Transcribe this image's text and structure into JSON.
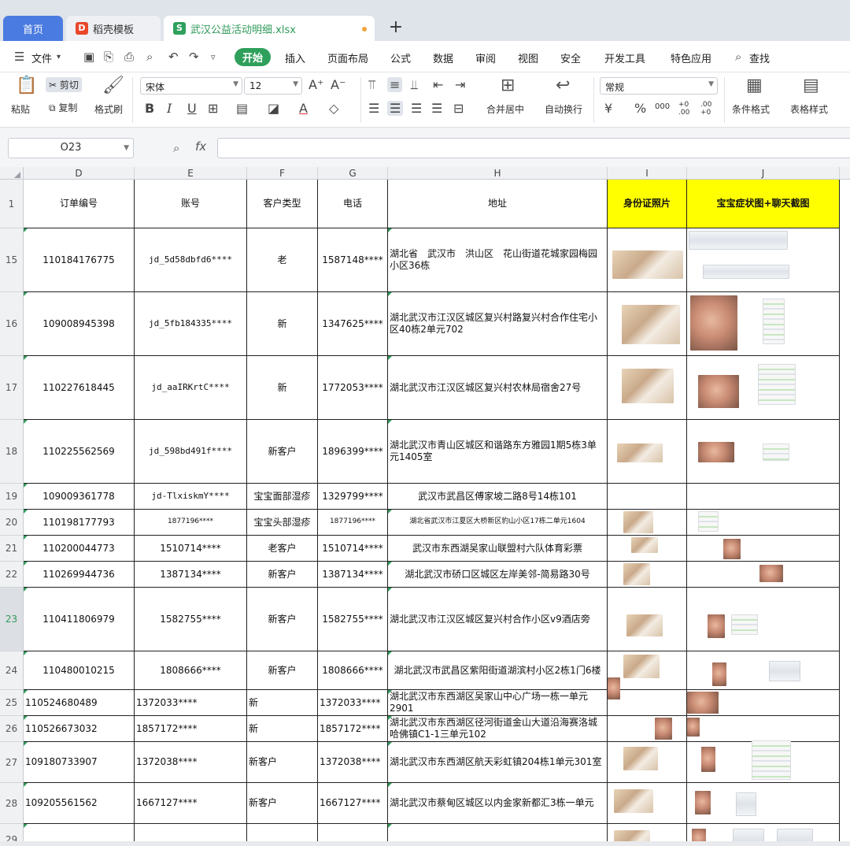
{
  "tabs": {
    "home": "首页",
    "template": "稻壳模板",
    "file": "武汉公益活动明细.xlsx",
    "add": "+"
  },
  "menu": {
    "file": "文件",
    "items": [
      "开始",
      "插入",
      "页面布局",
      "公式",
      "数据",
      "审阅",
      "视图",
      "安全",
      "开发工具",
      "特色应用"
    ],
    "search": "查找"
  },
  "ribbon": {
    "paste": "粘贴",
    "cut": "剪切",
    "copy": "复制",
    "format_painter": "格式刷",
    "font_name": "宋体",
    "font_size": "12",
    "bold": "B",
    "italic": "I",
    "underline": "U",
    "merge_center": "合并居中",
    "wrap_text": "自动换行",
    "number_format": "常规",
    "percent": "%",
    "thousands": "000",
    "inc_decimal": "+0 .00",
    "dec_decimal": ".00 +0",
    "conditional_format": "条件格式",
    "table_style": "表格样式"
  },
  "formula_bar": {
    "name_box": "O23",
    "fx": "fx",
    "formula": ""
  },
  "columns": [
    "D",
    "E",
    "F",
    "G",
    "H",
    "I",
    "J"
  ],
  "header_row": {
    "row": "1",
    "cells": [
      "订单编号",
      "账号",
      "客户类型",
      "电话",
      "地址",
      "身份证照片",
      "宝宝症状图+聊天截图"
    ]
  },
  "rows": [
    {
      "row": "15",
      "order": "110184176775",
      "account": "jd_5d58dbfd6****",
      "type": "老",
      "phone": "1587148****",
      "address": "湖北省　武汉市　洪山区　花山街道花城家园梅园小区36栋"
    },
    {
      "row": "16",
      "order": "109008945398",
      "account": "jd_5fb184335****",
      "type": "新",
      "phone": "1347625****",
      "address": "湖北武汉市江汉区城区复兴村路复兴村合作住宅小区40栋2单元702"
    },
    {
      "row": "17",
      "order": "110227618445",
      "account": "jd_aaIRKrtC****",
      "type": "新",
      "phone": "1772053****",
      "address": "湖北武汉市江汉区城区复兴村农林局宿舍27号"
    },
    {
      "row": "18",
      "order": "110225562569",
      "account": "jd_598bd491f****",
      "type": "新客户",
      "phone": "1896399****",
      "address": "湖北武汉市青山区城区和谐路东方雅园1期5栋3单元1405室"
    },
    {
      "row": "19",
      "order": "109009361778",
      "account": "jd-TlxiskmY****",
      "type": "宝宝面部湿疹",
      "phone": "1329799****",
      "address": "武汉市武昌区傅家坡二路8号14栋101"
    },
    {
      "row": "20",
      "order": "110198177793",
      "account": "1877196****",
      "type": "宝宝头部湿疹",
      "phone": "1877196****",
      "address": "湖北省武汉市江夏区大桥新区豹山小区17栋二单元1604"
    },
    {
      "row": "21",
      "order": "110200044773",
      "account": "1510714****",
      "type": "老客户",
      "phone": "1510714****",
      "address": "武汉市东西湖吴家山联盟村六队体育彩票"
    },
    {
      "row": "22",
      "order": "110269944736",
      "account": "1387134****",
      "type": "新客户",
      "phone": "1387134****",
      "address": "湖北武汉市硚口区城区左岸美邻-简易路30号"
    },
    {
      "row": "23",
      "order": "110411806979",
      "account": "1582755****",
      "type": "新客户",
      "phone": "1582755****",
      "address": "湖北武汉市江汉区城区复兴村合作小区v9酒店旁"
    },
    {
      "row": "24",
      "order": "110480010215",
      "account": "1808666****",
      "type": "新客户",
      "phone": "1808666****",
      "address": "湖北武汉市武昌区紫阳街道湖滨村小区2栋1门6楼"
    },
    {
      "row": "25",
      "order": "110524680489",
      "account": "1372033****",
      "type": "新",
      "phone": "1372033****",
      "address": "湖北武汉市东西湖区吴家山中心广场一栋一单元2901"
    },
    {
      "row": "26",
      "order": "110526673032",
      "account": "1857172****",
      "type": "新",
      "phone": "1857172****",
      "address": "湖北武汉市东西湖区径河街道金山大道沿海赛洛城哈佛镇C1-1三单元102"
    },
    {
      "row": "27",
      "order": "109180733907",
      "account": "1372038****",
      "type": "新客户",
      "phone": "1372038****",
      "address": "湖北武汉市东西湖区航天彩虹镇204栋1单元301室"
    },
    {
      "row": "28",
      "order": "109205561562",
      "account": "1667127****",
      "type": "新客户",
      "phone": "1667127****",
      "address": "湖北武汉市蔡甸区城区以内金家新都汇3栋一单元"
    },
    {
      "row": "29",
      "order": "",
      "account": "",
      "type": "",
      "phone": "",
      "address": ""
    }
  ]
}
